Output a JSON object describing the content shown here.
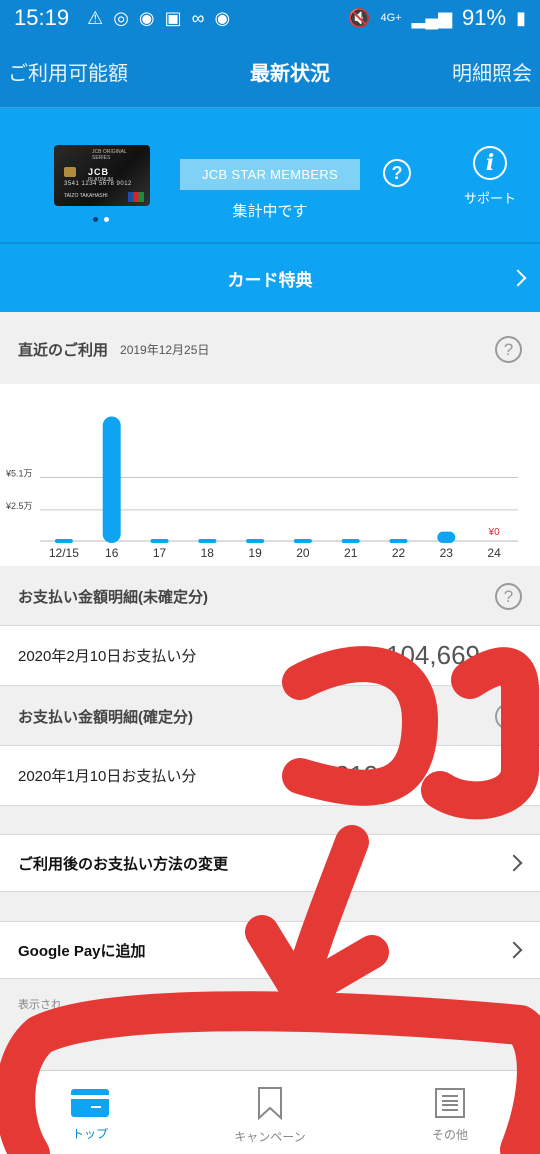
{
  "status_bar": {
    "time": "15:19",
    "battery": "91%",
    "network": "4G+"
  },
  "top_nav": {
    "left": "ご利用可能額",
    "center": "最新状況",
    "right": "明細照会"
  },
  "card_panel": {
    "card": {
      "series": "JCB ORIGINAL SERIES",
      "brand": "JCB",
      "tier": "PLATINUM",
      "number": "3541 1234 5678 9012",
      "holder": "TAIZO TAKAHASHI"
    },
    "members_badge": "JCB STAR MEMBERS",
    "status": "集計中です",
    "help_glyph": "?",
    "support_glyph": "i",
    "support_label": "サポート",
    "page_indicator": {
      "count": 2,
      "active": 0
    }
  },
  "benefits_label": "カード特典",
  "recent_usage": {
    "title": "直近のご利用",
    "date": "2019年12月25日",
    "help_glyph": "?"
  },
  "chart_data": {
    "type": "bar",
    "categories": [
      "12/15",
      "16",
      "17",
      "18",
      "19",
      "20",
      "21",
      "22",
      "23",
      "24"
    ],
    "values": [
      1500,
      100000,
      200,
      1500,
      500,
      1600,
      1000,
      100,
      7500,
      0
    ],
    "yticks": [
      {
        "value": 25000,
        "label": "¥2.5万"
      },
      {
        "value": 51000,
        "label": "¥5.1万"
      }
    ],
    "zero_label": "¥0",
    "ylim": [
      0,
      110000
    ],
    "bar_color": "#0ea4f3",
    "zero_label_color": "#e0212a",
    "grid": true
  },
  "pending": {
    "title": "お支払い金額明細(未確定分)",
    "help_glyph": "?",
    "row_label": "2020年2月10日お支払い分",
    "amount": "104,669",
    "unit": "円"
  },
  "confirmed": {
    "title": "お支払い金額明細(確定分)",
    "help_glyph": "?",
    "row_label": "2020年1月10日お支払い分",
    "amount": "319,1"
  },
  "menu": {
    "payment_change": "ご利用後のお支払い方法の変更",
    "google_pay": "Google Payに追加"
  },
  "disclaimer": "表示され　　　　　　　　　　　　のと異なる場合があります。",
  "bottom_nav": {
    "items": [
      {
        "label": "トップ",
        "icon": "card-icon",
        "active": true
      },
      {
        "label": "キャンペーン",
        "icon": "bookmark-icon",
        "active": false
      },
      {
        "label": "その他",
        "icon": "list-icon",
        "active": false
      }
    ]
  },
  "colors": {
    "primary": "#0f86d4",
    "panel": "#0ea4f3",
    "annotation": "#e53935"
  }
}
